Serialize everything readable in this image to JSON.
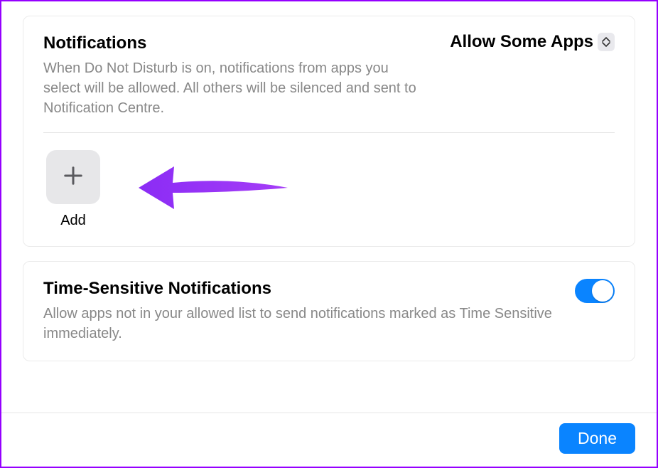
{
  "notifications": {
    "title": "Notifications",
    "description": "When Do Not Disturb is on, notifications from apps you select will be allowed. All others will be silenced and sent to Notification Centre.",
    "dropdown_selected": "Allow Some Apps",
    "add_label": "Add"
  },
  "time_sensitive": {
    "title": "Time-Sensitive Notifications",
    "description": "Allow apps not in your allowed list to send notifications marked as Time Sensitive immediately.",
    "toggle_on": true
  },
  "footer": {
    "done_label": "Done"
  },
  "colors": {
    "accent": "#0a84ff",
    "arrow": "#9a2cf6"
  }
}
